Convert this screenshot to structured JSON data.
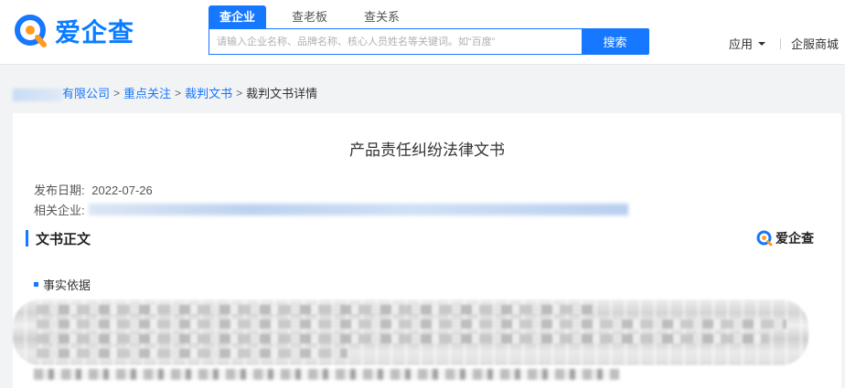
{
  "brand": {
    "name": "爱企查",
    "color": "#1677ff"
  },
  "search": {
    "tabs": [
      "查企业",
      "查老板",
      "查关系"
    ],
    "active_tab": 0,
    "placeholder": "请输入企业名称、品牌名称、核心人员姓名等关键词。如“百度”",
    "button": "搜索"
  },
  "top_nav": {
    "apps": "应用",
    "mall": "企服商城"
  },
  "breadcrumb": {
    "company_suffix": "有限公司",
    "items": [
      "重点关注",
      "裁判文书"
    ],
    "current": "裁判文书详情",
    "separator": ">"
  },
  "document": {
    "title": "产品责任纠纷法律文书",
    "publish_label": "发布日期:",
    "publish_date": "2022-07-26",
    "related_label": "相关企业:",
    "section_title": "文书正文",
    "watermark": "爱企查",
    "subsection": "事实依据"
  },
  "icons": {
    "logo": "magnifier-q-logo-icon",
    "caret": "caret-down-icon",
    "bullet": "square-bullet-icon",
    "section_marker": "vertical-bar-icon"
  }
}
